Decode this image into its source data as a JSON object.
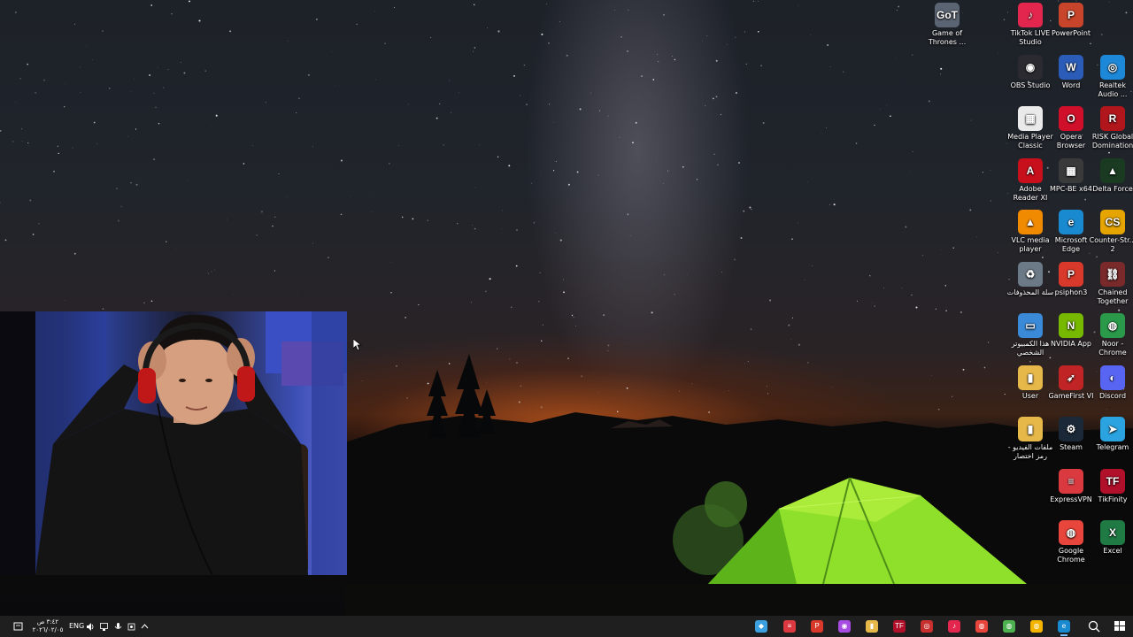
{
  "desktop_icons": [
    {
      "id": "game-of-thrones",
      "label": "Game of Thrones ...",
      "glyph": "GoT",
      "bg": "#5b6472"
    },
    {
      "id": "tiktok-live-studio",
      "label": "TikTok LIVE Studio",
      "glyph": "♪",
      "bg": "#e2264d"
    },
    {
      "id": "powerpoint",
      "label": "PowerPoint",
      "glyph": "P",
      "bg": "#c8442a"
    },
    {
      "id": "obs-studio",
      "label": "OBS Studio",
      "glyph": "◉",
      "bg": "#2a2a30"
    },
    {
      "id": "word",
      "label": "Word",
      "glyph": "W",
      "bg": "#2b5cb8"
    },
    {
      "id": "realtek-audio",
      "label": "Realtek Audio ...",
      "glyph": "◎",
      "bg": "#1e88d8"
    },
    {
      "id": "media-player-classic",
      "label": "Media Player Classic",
      "glyph": "▦",
      "bg": "#eaeaea"
    },
    {
      "id": "opera-browser",
      "label": "Opera Browser",
      "glyph": "O",
      "bg": "#d0102b"
    },
    {
      "id": "risk-global-domination",
      "label": "RISK Global Domination",
      "glyph": "R",
      "bg": "#b2161d"
    },
    {
      "id": "adobe-reader",
      "label": "Adobe Reader XI",
      "glyph": "A",
      "bg": "#c8101c"
    },
    {
      "id": "mpc-be",
      "label": "MPC-BE x64",
      "glyph": "▦",
      "bg": "#3a3a3a"
    },
    {
      "id": "delta-force",
      "label": "Delta Force",
      "glyph": "▲",
      "bg": "#1a3a22"
    },
    {
      "id": "vlc",
      "label": "VLC media player",
      "glyph": "▲",
      "bg": "#f08a00"
    },
    {
      "id": "microsoft-edge",
      "label": "Microsoft Edge",
      "glyph": "e",
      "bg": "#1a8ad0"
    },
    {
      "id": "counter-strike-2",
      "label": "Counter-Str... 2",
      "glyph": "CS",
      "bg": "#e5a400"
    },
    {
      "id": "recycle-bin",
      "label": "سلة المحذوفات",
      "glyph": "♻",
      "bg": "#6c7a88"
    },
    {
      "id": "psiphon3",
      "label": "psiphon3",
      "glyph": "P",
      "bg": "#d8392b"
    },
    {
      "id": "chained-together",
      "label": "Chained Together",
      "glyph": "⛓",
      "bg": "#7a2a2a"
    },
    {
      "id": "this-pc",
      "label": "هذا الكمبيوتر الشخصي",
      "glyph": "▭",
      "bg": "#3a8ad8"
    },
    {
      "id": "nvidia-app",
      "label": "NVIDIA App",
      "glyph": "N",
      "bg": "#76b900"
    },
    {
      "id": "noor-chrome",
      "label": "Noor - Chrome",
      "glyph": "◍",
      "bg": "#2a9a4a"
    },
    {
      "id": "user",
      "label": "User",
      "glyph": "▮",
      "bg": "#e6b84a"
    },
    {
      "id": "gamefirst",
      "label": "GameFirst VI",
      "glyph": "➶",
      "bg": "#c02424"
    },
    {
      "id": "discord",
      "label": "Discord",
      "glyph": "◐",
      "bg": "#5865f2"
    },
    {
      "id": "videos-shortcut",
      "label": "ملفات الفيديو - رمز اختصار",
      "glyph": "▮",
      "bg": "#e6b84a"
    },
    {
      "id": "steam",
      "label": "Steam",
      "glyph": "⚙",
      "bg": "#1b2838"
    },
    {
      "id": "telegram",
      "label": "Telegram",
      "glyph": "➤",
      "bg": "#2aa3e0"
    },
    {
      "id": "expressvpn",
      "label": "ExpressVPN",
      "glyph": "≡",
      "bg": "#da3940"
    },
    {
      "id": "tikfinity",
      "label": "TikFinity",
      "glyph": "TF",
      "bg": "#b0102a"
    },
    {
      "id": "google-chrome",
      "label": "Google Chrome",
      "glyph": "◍",
      "bg": "#e8453c"
    },
    {
      "id": "excel",
      "label": "Excel",
      "glyph": "X",
      "bg": "#1f7a44"
    }
  ],
  "taskbar": {
    "clock_time": "٣:٤٢ ص",
    "clock_date": "٢٠٢٦/٠٢/٠٥",
    "language": "ENG",
    "apps": [
      {
        "id": "app-1",
        "glyph": "◆",
        "color": "#3aa0e0"
      },
      {
        "id": "expressvpn",
        "glyph": "≡",
        "color": "#da3940"
      },
      {
        "id": "psiphon",
        "glyph": "P",
        "color": "#d8392b"
      },
      {
        "id": "messenger",
        "glyph": "◉",
        "color": "#a64ce0"
      },
      {
        "id": "file-explorer",
        "glyph": "▮",
        "color": "#e6b84a"
      },
      {
        "id": "tikfinity",
        "glyph": "TF",
        "color": "#b0102a"
      },
      {
        "id": "recorder",
        "glyph": "◎",
        "color": "#c83030"
      },
      {
        "id": "tiktok",
        "glyph": "♪",
        "color": "#e2264d"
      },
      {
        "id": "chrome",
        "glyph": "◍",
        "color": "#e8453c"
      },
      {
        "id": "chrome-2",
        "glyph": "◍",
        "color": "#4caf50"
      },
      {
        "id": "chrome-3",
        "glyph": "◍",
        "color": "#f4b400"
      },
      {
        "id": "edge",
        "glyph": "e",
        "color": "#1a8ad0"
      }
    ]
  }
}
